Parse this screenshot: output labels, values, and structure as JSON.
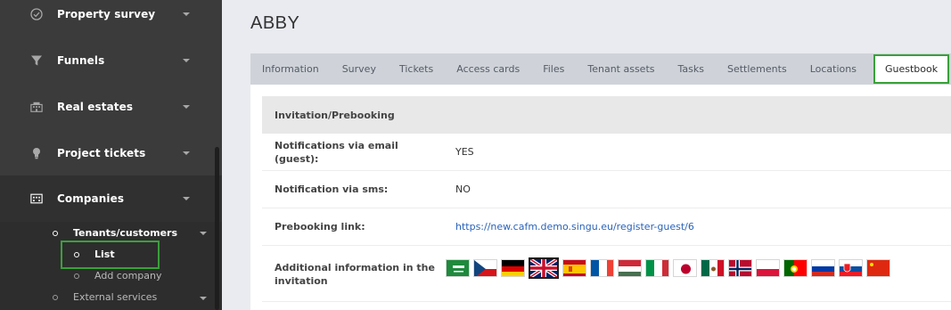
{
  "sidebar": {
    "items": [
      {
        "label": "Property survey",
        "icon": "check-circle-icon"
      },
      {
        "label": "Funnels",
        "icon": "funnel-icon"
      },
      {
        "label": "Real estates",
        "icon": "building-icon"
      },
      {
        "label": "Project tickets",
        "icon": "lightbulb-icon"
      },
      {
        "label": "Companies",
        "icon": "companies-icon"
      }
    ],
    "sub": {
      "group": "Tenants/customers",
      "list": "List",
      "add": "Add company",
      "external": "External services"
    }
  },
  "main": {
    "title": "ABBY",
    "tabs": [
      "Information",
      "Survey",
      "Tickets",
      "Access cards",
      "Files",
      "Tenant assets",
      "Tasks",
      "Settlements",
      "Locations",
      "Guestbook"
    ],
    "active_tab": "Guestbook",
    "section": "Invitation/Prebooking",
    "rows": [
      {
        "label": "Notifications via email (guest):",
        "value": "YES"
      },
      {
        "label": "Notification via sms:",
        "value": "NO"
      },
      {
        "label": "Prebooking link:",
        "value": "https://new.cafm.demo.singu.eu/register-guest/6"
      },
      {
        "label": "Additional information in the invitation"
      }
    ],
    "flags": [
      "saudi-arabia",
      "czech-republic",
      "germany",
      "united-kingdom",
      "spain",
      "france",
      "hungary",
      "italy",
      "japan",
      "mexico",
      "norway",
      "poland",
      "portugal",
      "russia",
      "slovakia",
      "china"
    ],
    "selected_flag": "united-kingdom"
  },
  "colors": {
    "sidebar_bg": "#3b3b3b",
    "highlight": "#3aa03a",
    "link": "#2a63b8"
  }
}
